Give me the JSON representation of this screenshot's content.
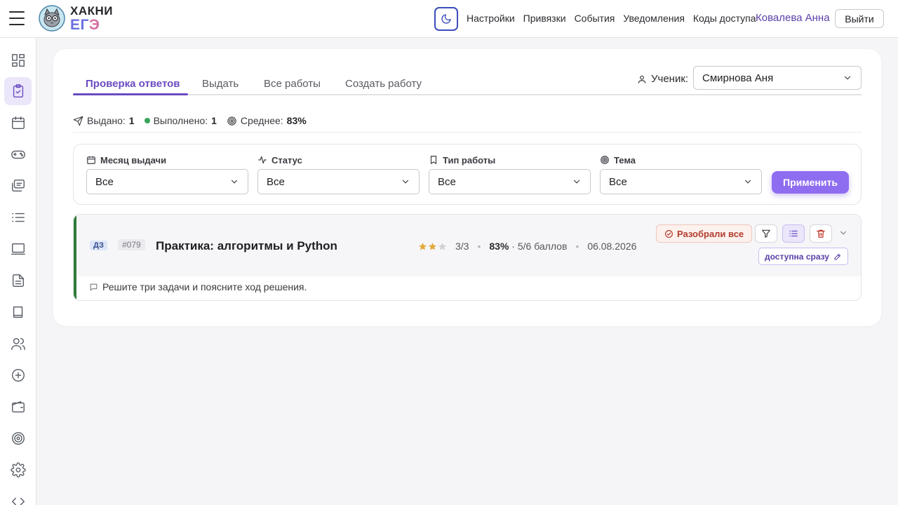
{
  "header": {
    "brand_line1": "ХАКНИ",
    "brand_line2_a": "ЕГ",
    "brand_line2_b": "Э",
    "nav": [
      "Настройки",
      "Привязки",
      "События",
      "Уведомления",
      "Коды доступа"
    ],
    "user_name": "Ковалева Анна",
    "logout_label": "Выйти"
  },
  "sidebar": {
    "items": [
      {
        "icon": "dashboard-icon"
      },
      {
        "icon": "clipboard-check-icon",
        "active": true
      },
      {
        "icon": "calendar-icon"
      },
      {
        "icon": "gamepad-icon"
      },
      {
        "icon": "chat-icon"
      },
      {
        "icon": "list-icon"
      },
      {
        "icon": "monitor-icon"
      },
      {
        "icon": "document-icon"
      },
      {
        "icon": "book-icon"
      },
      {
        "icon": "users-icon"
      },
      {
        "icon": "plus-circle-icon"
      },
      {
        "icon": "wallet-icon"
      },
      {
        "icon": "target-icon"
      },
      {
        "icon": "gear-icon"
      },
      {
        "icon": "code-icon"
      }
    ]
  },
  "tabs": [
    "Проверка ответов",
    "Выдать",
    "Все работы",
    "Создать работу"
  ],
  "active_tab": 0,
  "student": {
    "label": "Ученик:",
    "value": "Смирнова Аня"
  },
  "stats": {
    "issued_label": "Выдано:",
    "issued_value": "1",
    "done_label": "Выполнено:",
    "done_value": "1",
    "avg_label": "Среднее:",
    "avg_value": "83%"
  },
  "filters": [
    {
      "label": "Месяц выдачи",
      "value": "Все",
      "icon": "calendar-icon"
    },
    {
      "label": "Статус",
      "value": "Все",
      "icon": "activity-icon"
    },
    {
      "label": "Тип работы",
      "value": "Все",
      "icon": "bookmark-icon"
    },
    {
      "label": "Тема",
      "value": "Все",
      "icon": "target-icon"
    }
  ],
  "apply_label": "Применить",
  "work": {
    "type": "ДЗ",
    "number": "#079",
    "title": "Практика: алгоритмы и Python",
    "difficulty_stars": 2,
    "difficulty_max": 3,
    "tasks": "3/3",
    "score_percent": "83%",
    "score_points": "· 5/6 баллов",
    "date": "06.08.2026",
    "reviewed_label": "Разобрали все",
    "availability_label": "доступна сразу",
    "description": "Решите три задачи и поясните ход решения.",
    "colors": {
      "accent_bar": "#2f7a3a",
      "star": "#e2a93b",
      "star_empty": "#d0d0d5"
    }
  },
  "colors": {
    "primary": "#6a4bc2",
    "apply_button": "#8f6df0"
  }
}
